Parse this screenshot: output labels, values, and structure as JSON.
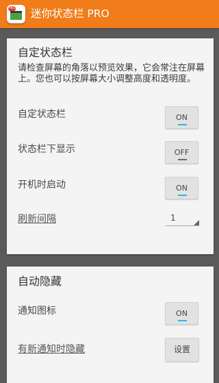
{
  "app": {
    "title": "迷你状态栏  PRO",
    "icon_badge": "PRO",
    "bar_color": "#f07d1a"
  },
  "statusbar_section": {
    "title": "自定状态栏",
    "description": "请检查屏幕的角落以预览效果，它会常注在屏幕上。您也可以按屏幕大小调整高度和透明度。",
    "rows": [
      {
        "label": "自定状态栏",
        "toggle": "ON"
      },
      {
        "label": "状态栏下显示",
        "toggle": "OFF"
      },
      {
        "label": "开机时启动",
        "toggle": "ON"
      }
    ],
    "refresh": {
      "label": "刷新间隔",
      "value": "1"
    }
  },
  "autohide_section": {
    "title": "自动隐藏",
    "rows": [
      {
        "label": "通知图标",
        "toggle": "ON"
      }
    ],
    "hide_on_notify": {
      "label": "有新通知时隐藏",
      "button": "设置"
    }
  },
  "colors": {
    "accent_on": "#29b6e8",
    "accent_off": "#6a6a6a",
    "background": "#5a5a5a",
    "card": "#f4f4f4"
  }
}
